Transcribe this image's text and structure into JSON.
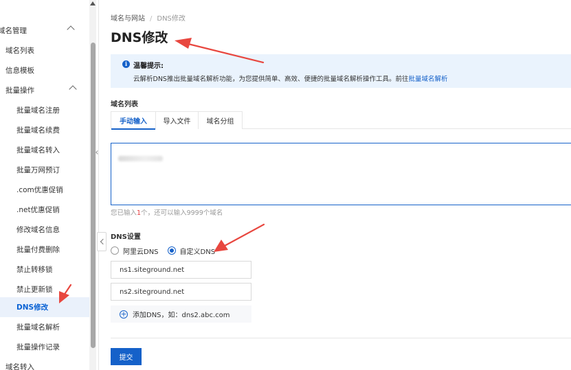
{
  "sidebar": {
    "items": [
      {
        "label": "域名管理",
        "expanded": true
      },
      {
        "label": "域名列表"
      },
      {
        "label": "信息模板"
      },
      {
        "label": "批量操作",
        "expanded": true
      },
      {
        "label": "批量域名注册"
      },
      {
        "label": "批量域名续费"
      },
      {
        "label": "批量域名转入"
      },
      {
        "label": "批量万网预订"
      },
      {
        "label": ".com优惠促销"
      },
      {
        "label": ".net优惠促销"
      },
      {
        "label": "修改域名信息"
      },
      {
        "label": "批量付费删除"
      },
      {
        "label": "禁止转移锁"
      },
      {
        "label": "禁止更新锁"
      },
      {
        "label": "DNS修改",
        "active": true
      },
      {
        "label": "批量域名解析"
      },
      {
        "label": "批量操作记录"
      },
      {
        "label": "域名转入"
      }
    ]
  },
  "breadcrumb": {
    "parent": "域名与网站",
    "separator": "/",
    "current": "DNS修改"
  },
  "page_title": "DNS修改",
  "notice": {
    "icon": "info-icon",
    "title": "温馨提示:",
    "text": "云解析DNS推出批量域名解析功能，为您提供简单、高效、便捷的批量域名解析操作工具。前往",
    "link": "批量域名解析"
  },
  "domain_list": {
    "label": "域名列表",
    "tabs": [
      {
        "label": "手动输入",
        "active": true
      },
      {
        "label": "导入文件"
      },
      {
        "label": "域名分组"
      }
    ],
    "hint_prefix": "您已输入",
    "hint_count": "1",
    "hint_suffix": "个，还可以输入9999个域名"
  },
  "dns_settings": {
    "label": "DNS设置",
    "options": [
      {
        "label": "阿里云DNS",
        "checked": false
      },
      {
        "label": "自定义DNS",
        "checked": true
      }
    ],
    "servers": [
      "ns1.siteground.net",
      "ns2.siteground.net"
    ],
    "add_label": "添加DNS，如：dns2.abc.com"
  },
  "submit_label": "提交",
  "colors": {
    "primary": "#1561c9",
    "annotation": "#e8473f",
    "notice_bg": "#eaf3fd",
    "active_item_bg": "#eaf1fb"
  }
}
